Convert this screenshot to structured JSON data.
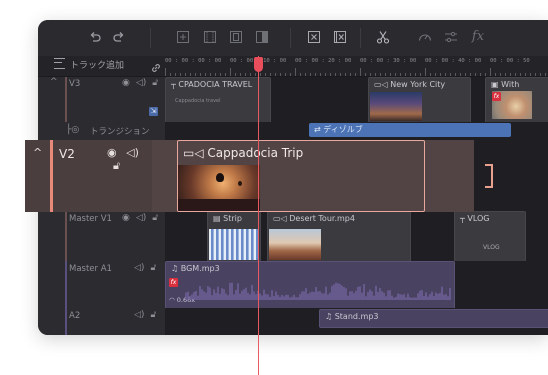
{
  "toolbar": {
    "undo_icon": "undo-icon",
    "redo_icon": "redo-icon",
    "icons": [
      "add-clip-icon",
      "filmstrip-icon",
      "split-frame-icon",
      "panel-icon",
      "delete-icon",
      "delete-gap-icon",
      "scissors-icon",
      "speed-icon",
      "audio-adjust-icon",
      "effects-fx-icon"
    ],
    "fx_label": "fx"
  },
  "header": {
    "add_track": "トラック追加",
    "ruler_labels": [
      "00 : 00 : 00 : 00",
      "00 : 00 : 10 : 00",
      "00 : 00 : 20 : 00",
      "00 : 00 : 30 : 00",
      "00 : 00 : 40 : 00",
      "00 : 00 : 50"
    ]
  },
  "tracks": {
    "v3": {
      "name": "V3",
      "clips": {
        "cappadocia_travel": "CPADOCIA TRAVEL",
        "cappadocia_small": "Cappadocia travel",
        "new_york": "New York City",
        "with": "With"
      }
    },
    "transition": {
      "name": "トランジション",
      "clip": "ディゾルブ"
    },
    "v2": {
      "name": "V2",
      "clip": "Cappadocia Trip"
    },
    "master_v1": {
      "name": "Master V1",
      "clips": {
        "strip": "Strip",
        "desert": "Desert Tour.mp4",
        "vlog": "VLOG",
        "vlog_small": "VLOG"
      }
    },
    "master_a1": {
      "name": "Master A1",
      "clip": "BGM.mp3",
      "fx": "fx",
      "speed": "0.66x"
    },
    "a2": {
      "name": "A2",
      "clip": "Stand.mp3"
    }
  },
  "colors": {
    "accent_red": "#e84e5c",
    "transition_blue": "#4b73b6",
    "audio_purple": "#4a4261",
    "v2_highlight": "#524444"
  }
}
